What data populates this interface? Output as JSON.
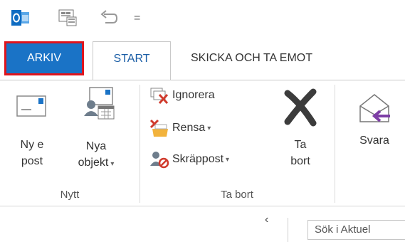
{
  "qat": {
    "items": [
      "outlook-logo-icon",
      "send-receive-icon",
      "undo-icon",
      "customize-qat-icon"
    ],
    "more_glyph": "="
  },
  "tabs": [
    {
      "label": "ARKIV"
    },
    {
      "label": "START"
    },
    {
      "label": "SKICKA OCH TA EMOT"
    }
  ],
  "ribbon": {
    "groups": [
      {
        "label": "Nytt",
        "buttons": [
          {
            "line1": "Ny e",
            "line2": "post"
          },
          {
            "line1": "Nya",
            "line2": "objekt"
          }
        ]
      },
      {
        "label": "Ta bort",
        "small_buttons": [
          {
            "label": "Ignorera"
          },
          {
            "label": "Rensa"
          },
          {
            "label": "Skräppost"
          }
        ],
        "buttons": [
          {
            "line1": "Ta",
            "line2": "bort"
          }
        ]
      },
      {
        "buttons": [
          {
            "line1": "Svara"
          }
        ]
      }
    ],
    "colors": {
      "accent": "#1a73c6",
      "highlight_border": "#e0141c",
      "tab_text": "#1b5ea6",
      "delete_x": "#3c3c3c",
      "reply_arrow": "#7e3fa6"
    }
  },
  "bottom": {
    "collapse_glyph": "‹",
    "search_placeholder": "Sök i Aktuel"
  }
}
